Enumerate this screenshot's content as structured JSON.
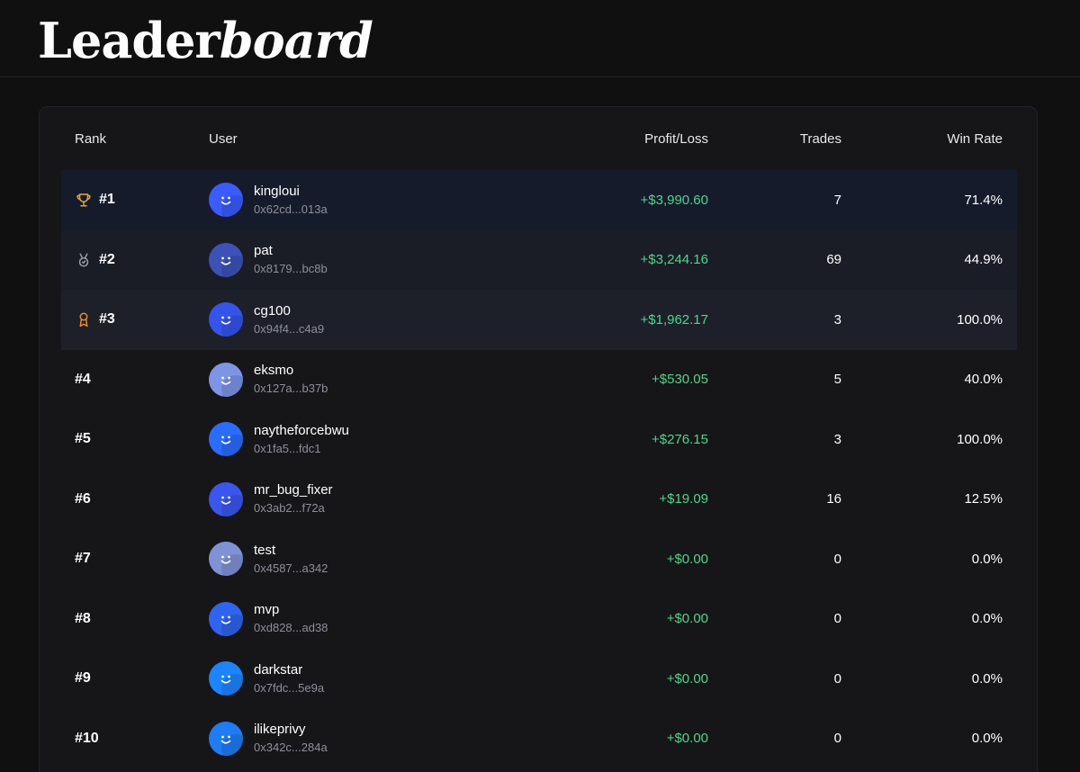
{
  "header": {
    "title_regular": "Leader",
    "title_italic": "board"
  },
  "table": {
    "columns": {
      "rank": "Rank",
      "user": "User",
      "profit_loss": "Profit/Loss",
      "trades": "Trades",
      "win_rate": "Win Rate"
    },
    "rows": [
      {
        "rank": "#1",
        "icon": "trophy-icon",
        "username": "kingloui",
        "address": "0x62cd...013a",
        "profit_loss": "+$3,990.60",
        "trades": "7",
        "win_rate": "71.4%",
        "avatar_color": "#3b5bff"
      },
      {
        "rank": "#2",
        "icon": "medal-icon",
        "username": "pat",
        "address": "0x8179...bc8b",
        "profit_loss": "+$3,244.16",
        "trades": "69",
        "win_rate": "44.9%",
        "avatar_color": "#3c52b8"
      },
      {
        "rank": "#3",
        "icon": "award-ribbon-icon",
        "username": "cg100",
        "address": "0x94f4...c4a9",
        "profit_loss": "+$1,962.17",
        "trades": "3",
        "win_rate": "100.0%",
        "avatar_color": "#3554ee"
      },
      {
        "rank": "#4",
        "icon": "",
        "username": "eksmo",
        "address": "0x127a...b37b",
        "profit_loss": "+$530.05",
        "trades": "5",
        "win_rate": "40.0%",
        "avatar_color": "#7d95e6"
      },
      {
        "rank": "#5",
        "icon": "",
        "username": "naytheforcebwu",
        "address": "0x1fa5...fdc1",
        "profit_loss": "+$276.15",
        "trades": "3",
        "win_rate": "100.0%",
        "avatar_color": "#2a6cff"
      },
      {
        "rank": "#6",
        "icon": "",
        "username": "mr_bug_fixer",
        "address": "0x3ab2...f72a",
        "profit_loss": "+$19.09",
        "trades": "16",
        "win_rate": "12.5%",
        "avatar_color": "#3a56ee"
      },
      {
        "rank": "#7",
        "icon": "",
        "username": "test",
        "address": "0x4587...a342",
        "profit_loss": "+$0.00",
        "trades": "0",
        "win_rate": "0.0%",
        "avatar_color": "#7f92d8"
      },
      {
        "rank": "#8",
        "icon": "",
        "username": "mvp",
        "address": "0xd828...ad38",
        "profit_loss": "+$0.00",
        "trades": "0",
        "win_rate": "0.0%",
        "avatar_color": "#2f63f0"
      },
      {
        "rank": "#9",
        "icon": "",
        "username": "darkstar",
        "address": "0x7fdc...5e9a",
        "profit_loss": "+$0.00",
        "trades": "0",
        "win_rate": "0.0%",
        "avatar_color": "#1c84ff"
      },
      {
        "rank": "#10",
        "icon": "",
        "username": "ilikeprivy",
        "address": "0x342c...284a",
        "profit_loss": "+$0.00",
        "trades": "0",
        "win_rate": "0.0%",
        "avatar_color": "#1e7cf5"
      }
    ]
  },
  "colors": {
    "background": "#101010",
    "card": "#161618",
    "profit": "#4fd68a",
    "trophy": "#e9a92a",
    "medal": "#9a9ca6",
    "award": "#e88a32"
  }
}
